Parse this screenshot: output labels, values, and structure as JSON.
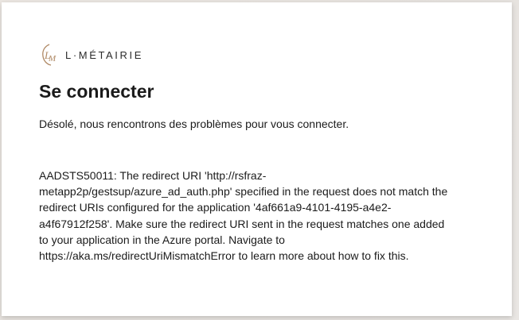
{
  "brand": {
    "name": "L·MÉTAIRIE",
    "monogram": "LM",
    "logo_color": "#b08a66"
  },
  "signin": {
    "title": "Se connecter",
    "message": "Désolé, nous rencontrons des problèmes pour vous connecter.",
    "error_lines": [
      "AADSTS50011: The redirect URI 'http://rsfraz-",
      "metapp2p/gestsup/azure_ad_auth.php' specified in the request does not match the",
      "redirect URIs configured for the application '4af661a9-4101-4195-a4e2-",
      "a4f67912f258'. Make sure the redirect URI sent in the request matches one added",
      "to your application in the Azure portal. Navigate to",
      "https://aka.ms/redirectUriMismatchError to learn more about how to fix this."
    ]
  }
}
